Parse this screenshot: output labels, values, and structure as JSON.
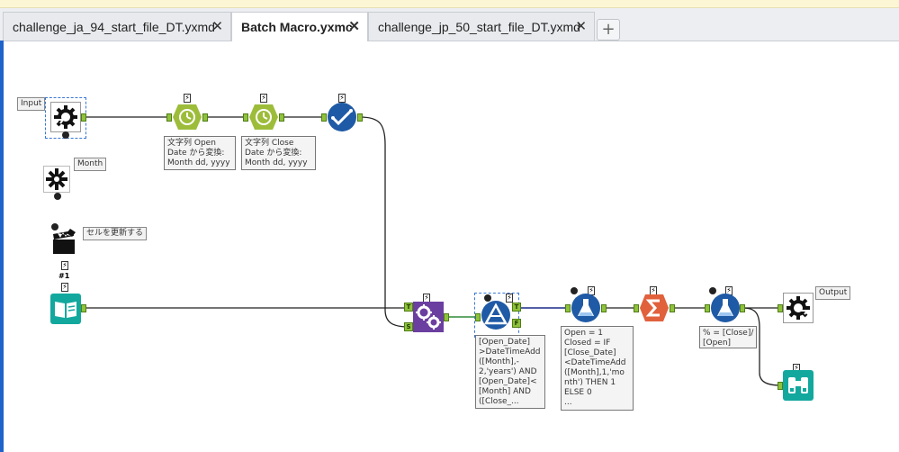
{
  "tabs": [
    {
      "label": "challenge_ja_94_start_file_DT.yxmd",
      "close": "✕",
      "active": false
    },
    {
      "label": "Batch Macro.yxmc",
      "close": "✕",
      "active": true
    },
    {
      "label": "challenge_jp_50_start_file_DT.yxmd",
      "close": "✕",
      "active": false
    }
  ],
  "add_tab": "+",
  "labels": {
    "input": "Input",
    "month": "Month",
    "update_cell": "セルを更新する",
    "output": "Output"
  },
  "annotations": {
    "datetime_open": "文字列 Open\nDate から変換:\nMonth dd, yyyy",
    "datetime_close": "文字列 Close\nDate から変換:\nMonth dd, yyyy",
    "filter": "[Open_Date]\n>DateTimeAdd\n([Month],-\n2,'years') AND\n[Open_Date]<\n[Month] AND\n([Close_...",
    "formula1": "Open = 1\nClosed = IF\n[Close_Date]\n<DateTimeAdd\n([Month],1,'mo\nnth') THEN 1\nELSE 0\n...",
    "formula2": "% = [Close]/\n[Open]"
  },
  "anchor_letters": {
    "true": "T",
    "false": "F",
    "join_t": "T",
    "join_s": "S"
  },
  "badge_text": {
    "lightning": "⚡",
    "hash": "#1"
  },
  "colors": {
    "accent": "#1e63c9",
    "datetime_tool": "#9dbd3a",
    "formula_tool": "#1f5aa6",
    "summarize_tool": "#e0613c",
    "join_tool": "#6b3fa0",
    "input_tool": "#13a89e",
    "wire": "#222222",
    "wire_highlight": "#1a2b8c"
  }
}
